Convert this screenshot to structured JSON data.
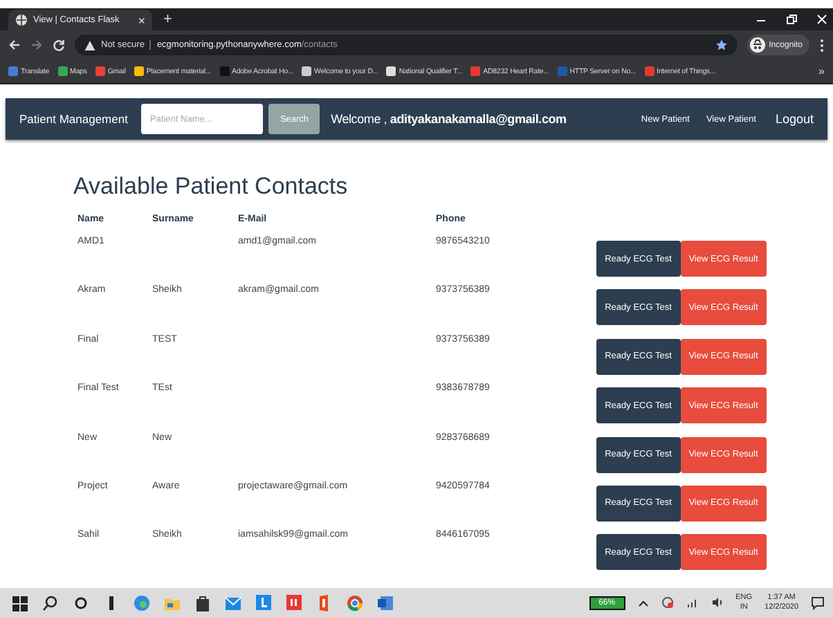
{
  "browser": {
    "tab": {
      "title": "View | Contacts Flask",
      "close": "×"
    },
    "new_tab": "+",
    "security": "Not secure",
    "url_host": "ecgmonitoring.pythonanywhere.com",
    "url_path": "/contacts",
    "profile": "Incognito",
    "bookmarks": [
      "Translate",
      "Maps",
      "Gmail",
      "Placement material...",
      "Adobe Acrobat Ho...",
      "Welcome to your D...",
      "National Qualifier T...",
      "AD8232 Heart Rate...",
      "HTTP Server on No...",
      "Internet of Things..."
    ],
    "more": "»"
  },
  "navbar": {
    "brand": "Patient Management",
    "search": {
      "placeholder": "Patient Name...",
      "button": "Search"
    },
    "welcome": "Welcome , **adityakanakamalla@gmail.com**",
    "links": [
      "New Patient",
      "View Patient",
      "Logout"
    ]
  },
  "heading": "Available Patient Contacts",
  "table": {
    "columns": [
      "Name",
      "Surname",
      "E-Mail",
      "Phone"
    ],
    "rows": [
      {
        "name": "AMD1",
        "surname": "",
        "email": "amd1@gmail.com",
        "phone": "9876543210",
        "actions": [
          {
            "label": "Ready ECG Test",
            "kind": "dark"
          },
          {
            "label": "View ECG Result",
            "kind": "danger"
          }
        ]
      },
      {
        "name": "Akram",
        "surname": "Sheikh",
        "email": "akram@gmail.com",
        "phone": "9373756389",
        "actions": [
          {
            "label": "Ready ECG Test",
            "kind": "dark"
          },
          {
            "label": "View ECG Result",
            "kind": "danger"
          }
        ]
      },
      {
        "name": "Final",
        "surname": "TEST",
        "email": "",
        "phone": "9373756389",
        "actions": [
          {
            "label": "Ready ECG Test",
            "kind": "dark"
          },
          {
            "label": "View ECG Result",
            "kind": "danger"
          }
        ]
      },
      {
        "name": "Final Test",
        "surname": "TEst",
        "email": "",
        "phone": "9383678789",
        "actions": [
          {
            "label": "Ready ECG Test",
            "kind": "dark"
          },
          {
            "label": "View ECG Result",
            "kind": "danger"
          }
        ]
      },
      {
        "name": "New",
        "surname": "New",
        "email": "",
        "phone": "9283768689",
        "actions": [
          {
            "label": "Ready ECG Test",
            "kind": "dark"
          },
          {
            "label": "View ECG Result",
            "kind": "danger"
          }
        ]
      },
      {
        "name": "Project",
        "surname": "Aware",
        "email": "projectaware@gmail.com",
        "phone": "9420597784",
        "actions": [
          {
            "label": "Ready ECG Test",
            "kind": "dark"
          },
          {
            "label": "View ECG Result",
            "kind": "danger"
          }
        ]
      },
      {
        "name": "Sahil",
        "surname": "Sheikh",
        "email": "iamsahilsk99@gmail.com",
        "phone": "8446167095",
        "actions": [
          {
            "label": "Ready ECG Test",
            "kind": "dark"
          },
          {
            "label": "View ECG Result",
            "kind": "danger"
          }
        ]
      }
    ]
  },
  "taskbar": {
    "battery": "66%",
    "language": "ENG",
    "region": "IN",
    "time": "1:37 AM",
    "date": "12/2/2020"
  }
}
